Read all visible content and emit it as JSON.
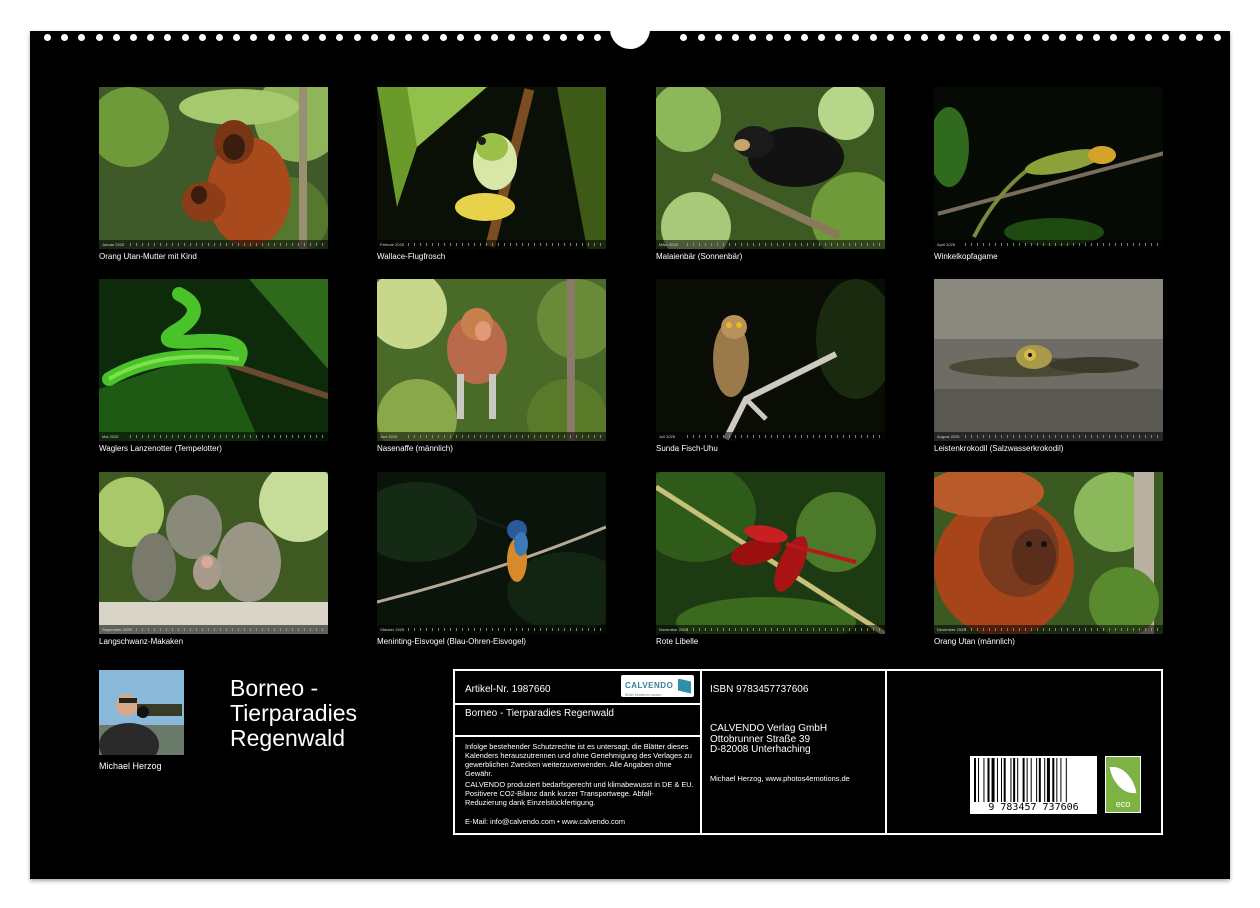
{
  "calendar": {
    "title": "Borneo - Tierparadies Regenwald",
    "title_lines": [
      "Borneo -",
      "Tierparadies",
      "Regenwald"
    ],
    "author": "Michael Herzog"
  },
  "photos": [
    {
      "caption": "Orang Utan-Mutter mit Kind",
      "month": "Januar 2025",
      "scene": "orangutan-mother"
    },
    {
      "caption": "Wallace-Flugfrosch",
      "month": "Februar 2025",
      "scene": "flying-frog"
    },
    {
      "caption": "Malaienbär (Sonnenbär)",
      "month": "März 2025",
      "scene": "sun-bear"
    },
    {
      "caption": "Winkelkopfagame",
      "month": "April 2025",
      "scene": "lizard"
    },
    {
      "caption": "Waglers Lanzenotter (Tempelotter)",
      "month": "Mai 2025",
      "scene": "viper"
    },
    {
      "caption": "Nasenaffe (männlich)",
      "month": "Juni 2025",
      "scene": "proboscis"
    },
    {
      "caption": "Sunda Fisch-Uhu",
      "month": "Juli 2025",
      "scene": "owl"
    },
    {
      "caption": "Leistenkrokodil (Salzwasserkrokodil)",
      "month": "August 2025",
      "scene": "crocodile"
    },
    {
      "caption": "Langschwanz-Makaken",
      "month": "September 2025",
      "scene": "macaques"
    },
    {
      "caption": "Meninting-Eisvogel (Blau-Ohren-Eisvogel)",
      "month": "Oktober 2025",
      "scene": "kingfisher"
    },
    {
      "caption": "Rote Libelle",
      "month": "November 2025",
      "scene": "dragonfly"
    },
    {
      "caption": "Orang Utan (männlich)",
      "month": "Dezember 2025",
      "scene": "orangutan-male"
    }
  ],
  "info": {
    "article": "Artikel-Nr. 1987660",
    "product_title": "Borneo - Tierparadies Regenwald",
    "legal_1": "Infolge bestehender Schutzrechte ist es untersagt, die Blätter dieses Kalenders herauszutrennen und ohne Genehmigung des Verlages zu gewerblichen Zwecken weiterzuverwenden. Alle Angaben ohne Gewähr.",
    "legal_2": "CALVENDO produziert bedarfsgerecht und klimabewusst in DE & EU. Positivere CO2-Bilanz dank kurzer Transportwege. Abfall-Reduzierung dank Einzelstückfertigung.",
    "contact": "E-Mail: info@calvendo.com • www.calvendo.com",
    "isbn": "ISBN 9783457737606",
    "publisher_name": "CALVENDO Verlag GmbH",
    "publisher_street": "Ottobrunner Straße 39",
    "publisher_city": "D-82008 Unterhaching",
    "credit": "Michael Herzog, www.photos4emotions.de",
    "barcode_digits": "9 783457 737606",
    "logo_word": "CALVENDO",
    "logo_sub": "Bilder bewahren lassen",
    "eco_label": "eco"
  },
  "colors": {
    "sheet": "#000000",
    "text": "#ffffff",
    "eco_green": "#7cb342",
    "calvendo_teal": "#2f8fa8"
  }
}
